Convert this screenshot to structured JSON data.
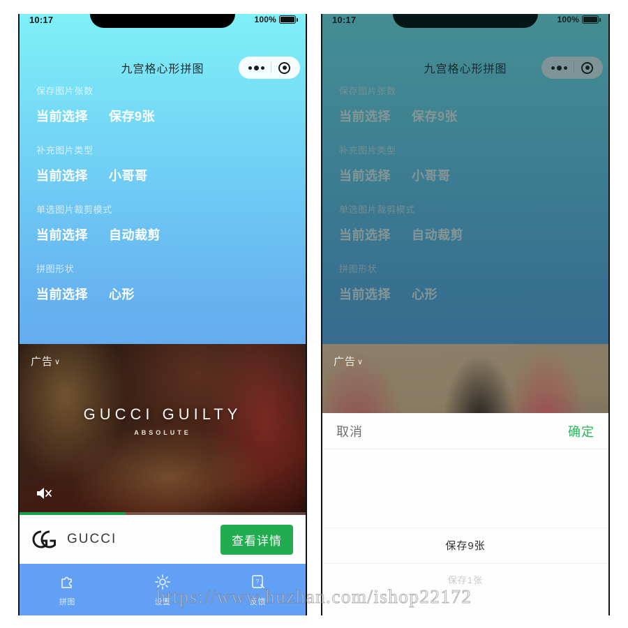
{
  "watermark": "https://www.huzhan.com/ishop22172",
  "status_bar": {
    "time": "10:17",
    "battery_percent": "100%"
  },
  "header": {
    "title": "九宫格心形拼图",
    "capsule_more_icon": "more-dots-icon",
    "capsule_target_icon": "target-circle-icon"
  },
  "settings": {
    "groups": [
      {
        "label": "保存图片张数",
        "key": "当前选择",
        "value": "保存9张"
      },
      {
        "label": "补充图片类型",
        "key": "当前选择",
        "value": "小哥哥"
      },
      {
        "label": "单选图片裁剪模式",
        "key": "当前选择",
        "value": "自动裁剪"
      },
      {
        "label": "拼图形状",
        "key": "当前选择",
        "value": "心形"
      }
    ]
  },
  "ad": {
    "tag": "广告",
    "tag_chevron": "∨",
    "brand_line": "GUCCI GUILTY",
    "sub_line": "ABSOLUTE",
    "mute_icon": "speaker-muted-icon",
    "progress_percent": 37,
    "footer": {
      "logo_icon": "gucci-double-g-icon",
      "advertiser": "GUCCI",
      "cta_label": "查看详情",
      "cta_color": "#21ad4f"
    }
  },
  "tab_bar": {
    "background": "#62a0f5",
    "items": [
      {
        "icon": "puzzle-piece-icon",
        "label": "拼图"
      },
      {
        "icon": "gear-icon",
        "label": "设置"
      },
      {
        "icon": "feedback-question-icon",
        "label": "反馈"
      }
    ]
  },
  "picker_sheet": {
    "cancel_label": "取消",
    "confirm_label": "确定",
    "confirm_color": "#23b85c",
    "options": [
      {
        "label": "保存9张",
        "selected": true
      },
      {
        "label": "保存1张",
        "selected": false
      }
    ]
  },
  "colors": {
    "gradient_top": "#7ef0f7",
    "gradient_bottom": "#64acef",
    "dim_overlay": "rgba(8,32,38,.52)"
  }
}
